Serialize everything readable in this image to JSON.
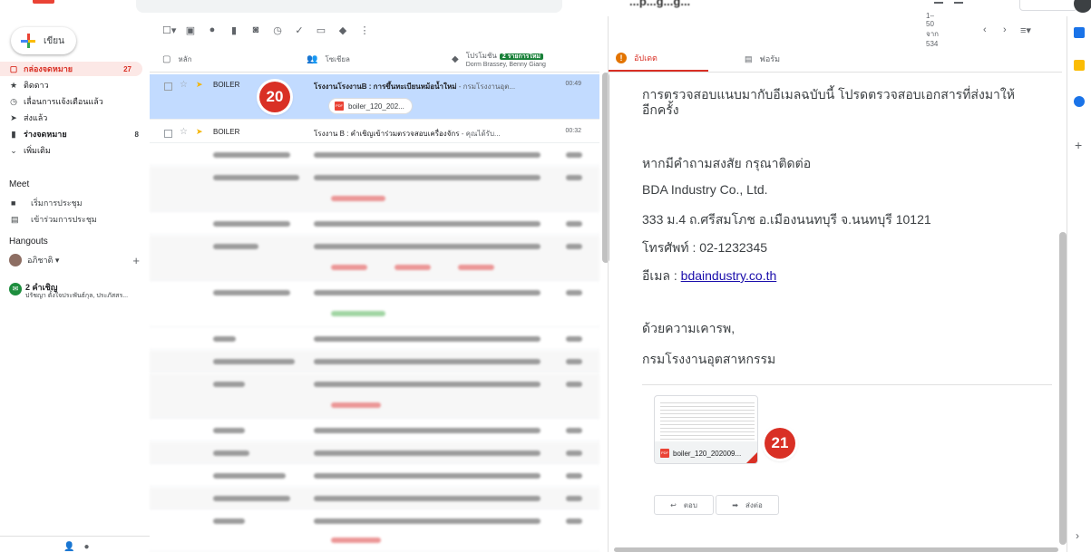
{
  "topbar": {
    "blurred_title": "...p...g...g..."
  },
  "sidebar": {
    "compose_label": "เขียน",
    "items": [
      {
        "icon": "inbox-icon",
        "glyph": "▢",
        "label": "กล่องจดหมาย",
        "count": "27"
      },
      {
        "icon": "star-icon",
        "glyph": "★",
        "label": "ติดดาว",
        "count": ""
      },
      {
        "icon": "clock-icon",
        "glyph": "◷",
        "label": "เลื่อนการแจ้งเตือนแล้ว",
        "count": ""
      },
      {
        "icon": "send-icon",
        "glyph": "➤",
        "label": "ส่งแล้ว",
        "count": ""
      },
      {
        "icon": "draft-icon",
        "glyph": "▮",
        "label": "ร่างจดหมาย",
        "count": "8"
      },
      {
        "icon": "chevron-down-icon",
        "glyph": "⌄",
        "label": "เพิ่มเติม",
        "count": ""
      }
    ],
    "meet_title": "Meet",
    "meet_items": [
      {
        "icon": "video-icon",
        "glyph": "■",
        "label": "เริ่มการประชุม"
      },
      {
        "icon": "keyboard-icon",
        "glyph": "▤",
        "label": "เข้าร่วมการประชุม"
      }
    ],
    "hangouts_title": "Hangouts",
    "hangouts_user": "อภิชาติ ▾",
    "invite_title": "2 คำเชิญ",
    "invite_sub": "ปรัชญา ตั้งใจประพันธ์กุล, ประภัสสร..."
  },
  "list": {
    "range": "1–50 จาก 534",
    "tabs": {
      "primary": "หลัก",
      "social": "โซเชียล",
      "promo": "โปรโมชัน",
      "promo_badge": "2 รายการใหม่",
      "promo_sub": "Dorm Brassey, Benny Giang"
    },
    "rows": [
      {
        "sender": "BOILER",
        "subject": "โรงงานโรงงานB : การขึ้นทะเบียนหม้อน้ำใหม่",
        "snippet": " - กรมโรงงานอุต...",
        "time": "00:49",
        "attachment": "boiler_120_202..."
      },
      {
        "sender": "BOILER",
        "subject": "โรงงาน B : คำเชิญเข้าร่วมตรวจสอบเครื่องจักร",
        "snippet": " - คุณได้รับ...",
        "time": "00:32"
      }
    ],
    "badge_20": "20"
  },
  "reading": {
    "tab_updates": "อัปเดต",
    "tab_forums": "ฟอรัม",
    "lines": [
      "การตรวจสอบแนบมากับอีเมลฉบับนี้ โปรดตรวจสอบเอกสารที่ส่งมาให้",
      "อีกครั้ง",
      "หากมีคำถามสงสัย กรุณาติดต่อ",
      "BDA Industry Co., Ltd.",
      "333 ม.4 ถ.ศรีสมโภช อ.เมืองนนทบุรี จ.นนทบุรี 10121",
      "โทรศัพท์ : 02-1232345",
      "อีเมล : ",
      "ด้วยความเคารพ,",
      "กรมโรงงานอุตสาหกรรม"
    ],
    "email_link": "bdaindustry.co.th",
    "attachment_name": "boiler_120_202009...",
    "badge_21": "21",
    "reply_label": "ตอบ",
    "forward_label": "ส่งต่อ"
  }
}
